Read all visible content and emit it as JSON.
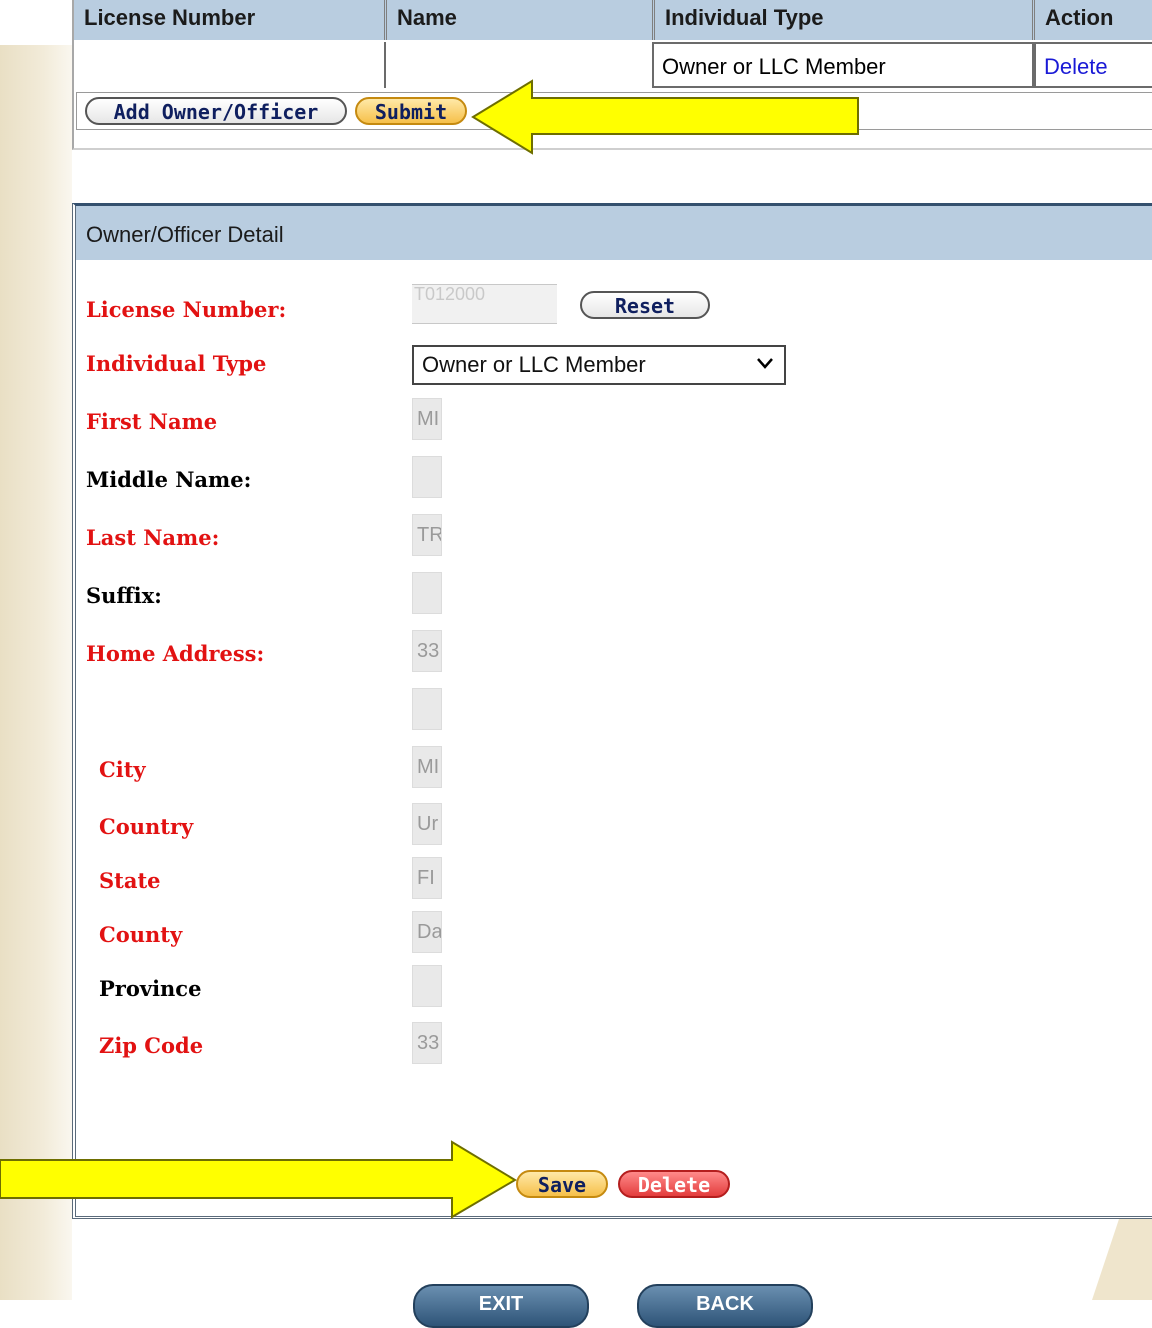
{
  "results_table": {
    "headers": [
      "License Number",
      "Name",
      "Individual Type",
      "Action"
    ],
    "row": {
      "license_number": "",
      "name": "",
      "individual_type": "Owner or LLC Member",
      "action": "Delete"
    },
    "buttons": {
      "add_owner": "Add Owner/Officer",
      "submit": "Submit"
    }
  },
  "detail": {
    "title": "Owner/Officer Detail",
    "fields": {
      "license_number": {
        "label": "License Number:",
        "value": "T012000",
        "reset_label": "Reset"
      },
      "individual_type": {
        "label": "Individual Type",
        "value": "Owner or LLC Member"
      },
      "first_name": {
        "label": "First Name",
        "value": "MI"
      },
      "middle_name": {
        "label": "Middle Name:",
        "value": ""
      },
      "last_name": {
        "label": "Last Name:",
        "value": "TR"
      },
      "suffix": {
        "label": "Suffix:",
        "value": ""
      },
      "home_address": {
        "label": "Home Address:",
        "value": "33",
        "value2": ""
      },
      "city": {
        "label": "City",
        "value": "MI"
      },
      "country": {
        "label": "Country",
        "value": "Ur"
      },
      "state": {
        "label": "State",
        "value": "FI"
      },
      "county": {
        "label": "County",
        "value": "Da"
      },
      "province": {
        "label": "Province",
        "value": ""
      },
      "zip": {
        "label": "Zip Code",
        "value": "33"
      }
    },
    "buttons": {
      "save": "Save",
      "delete": "Delete"
    }
  },
  "footer_buttons": {
    "exit": "EXIT",
    "back": "BACK"
  },
  "colors": {
    "required_label": "#e21212",
    "header_bg": "#b9cde0",
    "arrow_fill": "#ffff00",
    "gold_button": "#f6c04a",
    "red_button": "#e33d3d"
  },
  "icons": [
    "chevron-down-icon",
    "arrow-right-icon",
    "arrow-left-icon"
  ]
}
